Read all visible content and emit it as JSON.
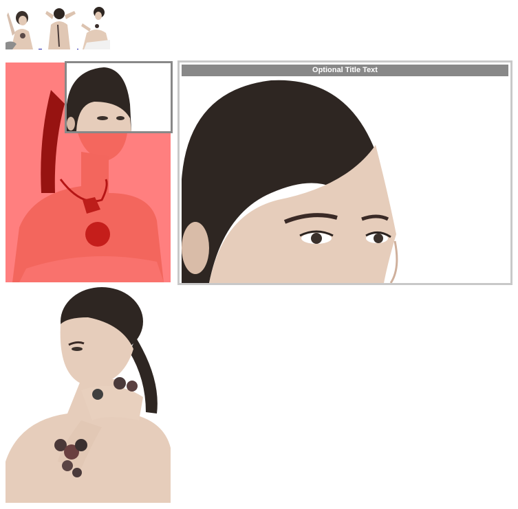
{
  "thumbnails": [
    {
      "icon": "thumbnail-necklace-portrait"
    },
    {
      "icon": "thumbnail-back-pose"
    },
    {
      "icon": "thumbnail-side-pose"
    }
  ],
  "zoom": {
    "title": "Optional Title Text",
    "lens_color": "#888888",
    "window_border_color": "#c8c8c8",
    "title_bg_color": "#888888",
    "overlay_tint": "#ff6b6b"
  },
  "colors": {
    "hair": "#2e2622",
    "skin": "#e6cfbe",
    "background": "#ffffff"
  }
}
